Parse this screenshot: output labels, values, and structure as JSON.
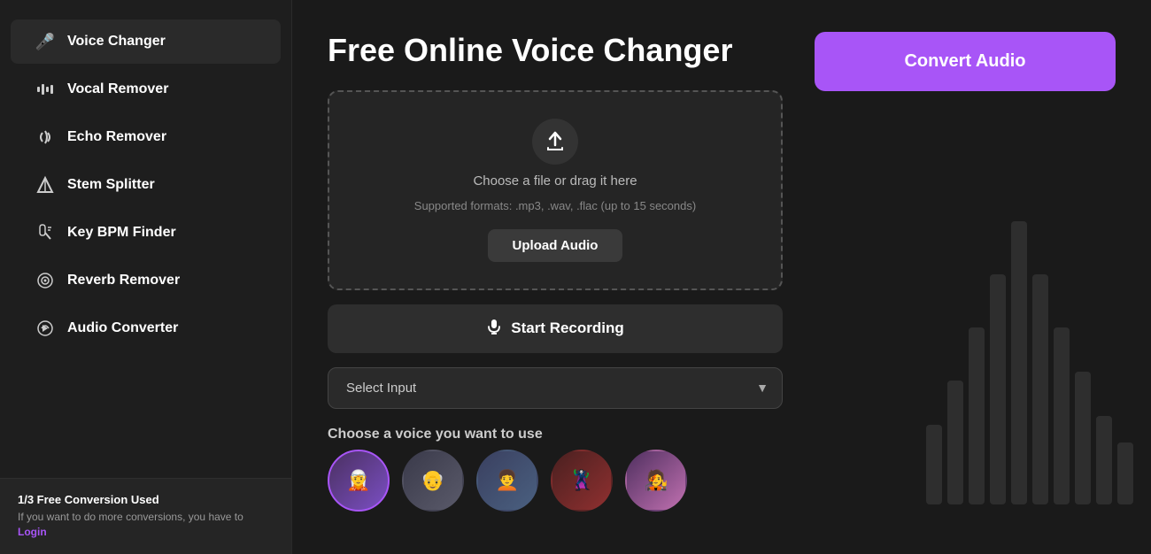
{
  "sidebar": {
    "items": [
      {
        "id": "voice-changer",
        "label": "Voice Changer",
        "icon": "🎤",
        "active": true
      },
      {
        "id": "vocal-remover",
        "label": "Vocal Remover",
        "icon": "🎵",
        "active": false
      },
      {
        "id": "echo-remover",
        "label": "Echo Remover",
        "icon": "🔊",
        "active": false
      },
      {
        "id": "stem-splitter",
        "label": "Stem Splitter",
        "icon": "△",
        "active": false
      },
      {
        "id": "key-bpm-finder",
        "label": "Key BPM Finder",
        "icon": "🔔",
        "active": false
      },
      {
        "id": "reverb-remover",
        "label": "Reverb Remover",
        "icon": "⚙",
        "active": false
      },
      {
        "id": "audio-converter",
        "label": "Audio Converter",
        "icon": "🔄",
        "active": false
      }
    ],
    "bottom": {
      "conversion_title": "1/3 Free Conversion Used",
      "conversion_desc": "If you want to do more conversions, you have to",
      "login_label": "Login"
    }
  },
  "main": {
    "page_title": "Free Online Voice Changer",
    "upload_area": {
      "icon": "⬆",
      "text_main": "Choose a file or drag it here",
      "text_sub": "Supported formats: .mp3, .wav, .flac (up to 15 seconds)",
      "upload_button_label": "Upload Audio"
    },
    "record_button_label": "Start Recording",
    "select_input": {
      "placeholder": "Select Input"
    },
    "voice_section": {
      "title": "Choose a voice you want to use",
      "voices": [
        {
          "id": "v1",
          "emoji": "🧝",
          "active": true
        },
        {
          "id": "v2",
          "emoji": "👴",
          "active": false
        },
        {
          "id": "v3",
          "emoji": "🧑‍🦱",
          "active": false
        },
        {
          "id": "v4",
          "emoji": "🦹",
          "active": false
        },
        {
          "id": "v5",
          "emoji": "🧑‍🎤",
          "active": false
        }
      ]
    },
    "convert_button_label": "Convert Audio"
  },
  "icons": {
    "mic": "🎤",
    "upload": "⬆",
    "dropdown_arrow": "▼",
    "microphone_small": "🎤"
  }
}
